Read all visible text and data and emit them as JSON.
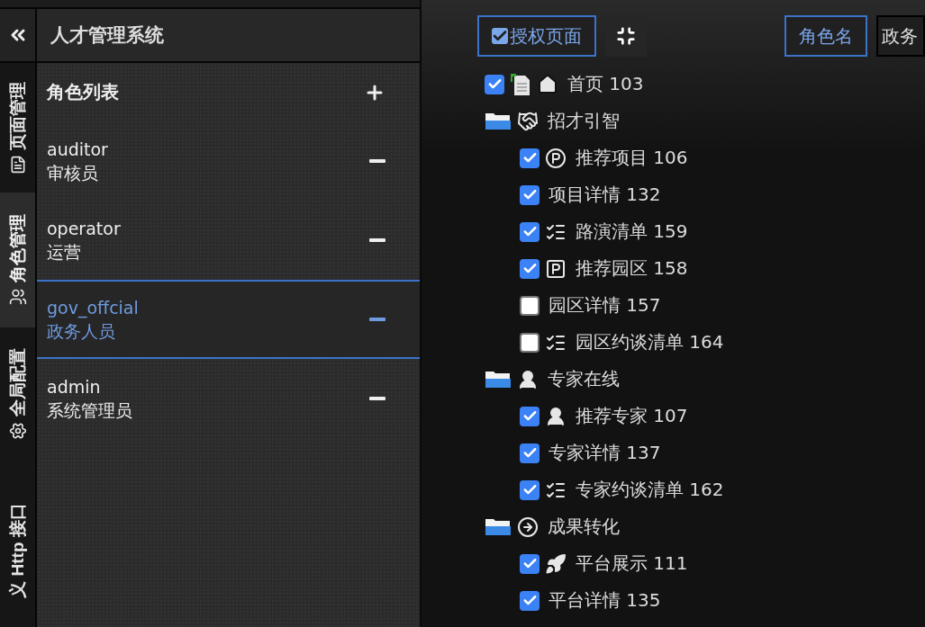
{
  "app": {
    "title": "人才管理系统"
  },
  "side_tabs": [
    {
      "label": "页面管理",
      "selected": false
    },
    {
      "label": "角色管理",
      "selected": true
    },
    {
      "label": "全局配置",
      "selected": false
    },
    {
      "label": "义 Http 接口",
      "selected": false
    }
  ],
  "roles": {
    "title": "角色列表",
    "items": [
      {
        "name": "auditor",
        "label": "审核员",
        "selected": false
      },
      {
        "name": "operator",
        "label": "运营",
        "selected": false
      },
      {
        "name": "gov_offcial",
        "label": "政务人员",
        "selected": true
      },
      {
        "name": "admin",
        "label": "系统管理员",
        "selected": false
      }
    ]
  },
  "toolbar": {
    "authorize_button": "授权页面",
    "role_name_button": "角色名",
    "role_name_value": "政务"
  },
  "tree": [
    {
      "kind": "page",
      "label": "首页 103",
      "checked": true
    },
    {
      "kind": "folder",
      "label": "招才引智",
      "children": [
        {
          "kind": "page",
          "label": "推荐项目 106",
          "checked": true
        },
        {
          "kind": "page",
          "label": "项目详情 132",
          "checked": true
        },
        {
          "kind": "page",
          "label": "路演清单 159",
          "checked": true
        },
        {
          "kind": "page",
          "label": "推荐园区 158",
          "checked": true
        },
        {
          "kind": "page",
          "label": "园区详情 157",
          "checked": false
        },
        {
          "kind": "page",
          "label": "园区约谈清单 164",
          "checked": false
        }
      ]
    },
    {
      "kind": "folder",
      "label": "专家在线",
      "children": [
        {
          "kind": "page",
          "label": "推荐专家 107",
          "checked": true
        },
        {
          "kind": "page",
          "label": "专家详情 137",
          "checked": true
        },
        {
          "kind": "page",
          "label": "专家约谈清单 162",
          "checked": true
        }
      ]
    },
    {
      "kind": "folder",
      "label": "成果转化",
      "children": [
        {
          "kind": "page",
          "label": "平台展示 111",
          "checked": true
        },
        {
          "kind": "page",
          "label": "平台详情 135",
          "checked": true
        }
      ]
    }
  ]
}
